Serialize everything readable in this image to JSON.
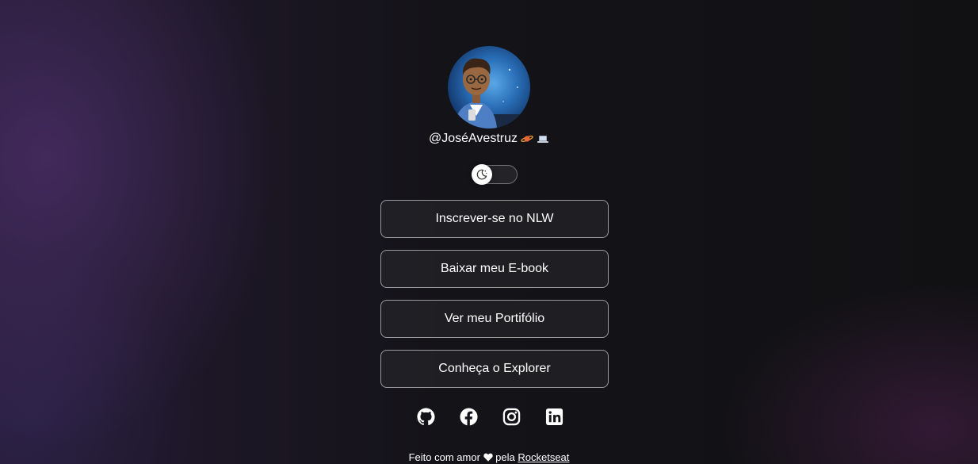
{
  "profile": {
    "username": "@JoséAvestruz",
    "username_emojis": [
      "planet-icon",
      "laptop-icon"
    ],
    "avatar_alt": "Foto de José Avestruz"
  },
  "theme_switch": {
    "icon": "moon-icon",
    "state": "dark"
  },
  "links": [
    {
      "label": "Inscrever-se no NLW"
    },
    {
      "label": "Baixar meu E-book"
    },
    {
      "label": "Ver meu Portifólio"
    },
    {
      "label": "Conheça o Explorer"
    }
  ],
  "social": [
    "github-icon",
    "facebook-icon",
    "instagram-icon",
    "linkedin-icon"
  ],
  "footer": {
    "prefix": "Feito com amor",
    "middle": "pela",
    "link_label": "Rocketseat"
  },
  "colors": {
    "background": "#121214",
    "accent_purple": "#5c3880",
    "text": "#ffffff"
  }
}
